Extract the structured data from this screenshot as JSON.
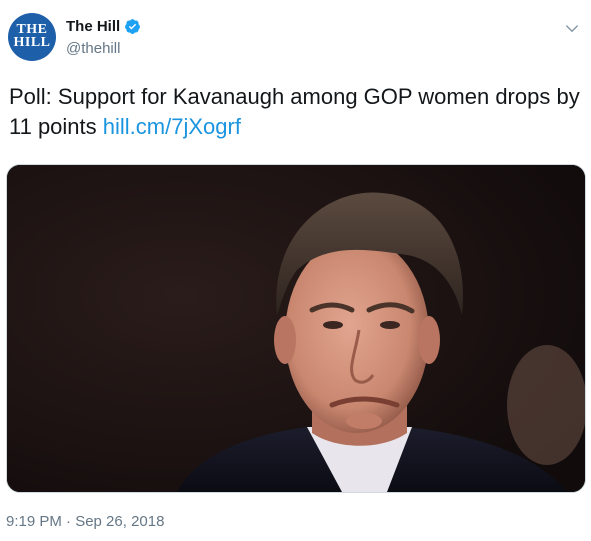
{
  "account": {
    "avatar_text": [
      "THE",
      "HILL"
    ],
    "display_name": "The Hill",
    "handle": "@thehill",
    "verified": true
  },
  "tweet": {
    "text": "Poll: Support for Kavanaugh among GOP women drops by 11 points ",
    "link": "hill.cm/7jXogrf"
  },
  "media": {
    "description_icon": "photo-image"
  },
  "meta": {
    "timestamp": "9:19 PM · Sep 26, 2018"
  },
  "colors": {
    "link": "#1b95e0",
    "verified": "#1da1f2",
    "avatar": "#1d5fa8",
    "secondary_text": "#657786"
  },
  "icons": {
    "verified": "verified-badge-icon",
    "menu": "chevron-down-icon"
  }
}
